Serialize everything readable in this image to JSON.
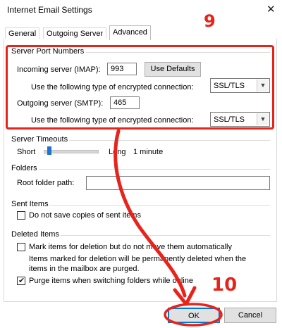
{
  "window": {
    "title": "Internet Email Settings"
  },
  "tabs": [
    {
      "label": "General"
    },
    {
      "label": "Outgoing Server"
    },
    {
      "label": "Advanced"
    }
  ],
  "server_ports": {
    "group_label": "Server Port Numbers",
    "incoming_label": "Incoming server (IMAP):",
    "incoming_value": "993",
    "use_defaults_label": "Use Defaults",
    "incoming_encryption_label": "Use the following type of encrypted connection:",
    "incoming_encryption_value": "SSL/TLS",
    "outgoing_label": "Outgoing server (SMTP):",
    "outgoing_value": "465",
    "outgoing_encryption_label": "Use the following type of encrypted connection:",
    "outgoing_encryption_value": "SSL/TLS"
  },
  "timeouts": {
    "group_label": "Server Timeouts",
    "short_label": "Short",
    "long_label": "Long",
    "value": "1 minute",
    "slider_level": 0.1
  },
  "folders": {
    "group_label": "Folders",
    "root_label": "Root folder path:",
    "root_value": ""
  },
  "sent_items": {
    "group_label": "Sent Items",
    "dont_save_label": "Do not save copies of sent items",
    "dont_save_checked": false
  },
  "deleted_items": {
    "group_label": "Deleted Items",
    "mark_label": "Mark items for deletion but do not move them automatically",
    "mark_checked": false,
    "hint_line1": "Items marked for deletion will be permanently deleted when the",
    "hint_line2": "items in the mailbox are purged.",
    "purge_label": "Purge items when switching folders while online",
    "purge_checked": true
  },
  "footer": {
    "ok_label": "OK",
    "cancel_label": "Cancel"
  },
  "annotations": {
    "step_a": "9",
    "step_b": "10"
  },
  "colors": {
    "annotation": "#e8231b",
    "slider_thumb": "#1e74d2"
  }
}
